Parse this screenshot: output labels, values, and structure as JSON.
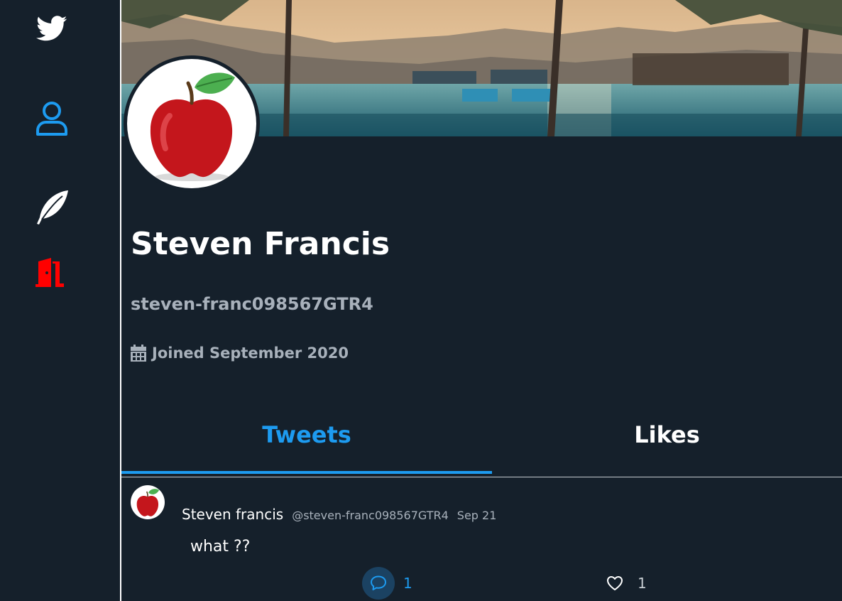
{
  "profile": {
    "name": "Steven Francis",
    "handle": "steven-franc098567GTR4",
    "joined": "Joined September 2020"
  },
  "tabs": [
    {
      "label": "Tweets",
      "active": true
    },
    {
      "label": "Likes",
      "active": false
    }
  ],
  "tweets": [
    {
      "author": "Steven francis",
      "handle": "@steven-franc098567GTR4",
      "date": "Sep 21",
      "text": "what ??",
      "replies": "1",
      "likes": "1"
    }
  ],
  "icons": {
    "nav": [
      "twitter-bird-icon",
      "profile-icon",
      "feather-icon",
      "logout-door-icon"
    ],
    "profile": [
      "calendar-icon"
    ],
    "tweet_actions": [
      "reply-icon",
      "heart-icon"
    ]
  },
  "colors": {
    "background": "#15202b",
    "accent": "#1d9bf0",
    "logout": "#ff0000",
    "muted_text": "#a8b1bb"
  }
}
